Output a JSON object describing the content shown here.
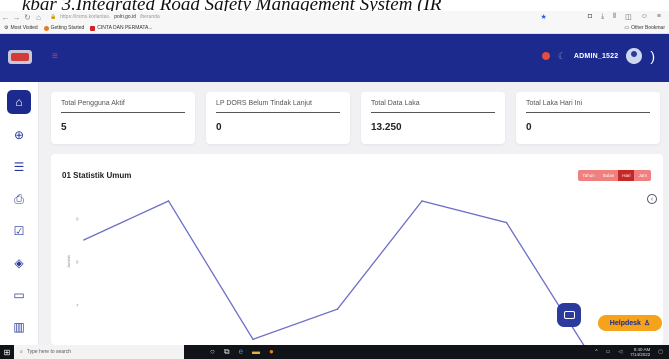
{
  "caption": "kbar 3.Integrated Road Safety Management System (IR",
  "browser": {
    "url_prefix": "https://irsms.korlantas.",
    "url_domain": "polri.go.id",
    "url_suffix": "/beranda",
    "bookmarks": [
      "Most Visited",
      "Getting Started",
      "CINTA DAN PERMATA..."
    ],
    "other_bookmarks": "Other Bookmar"
  },
  "header": {
    "admin_label": "ADMIN_1522"
  },
  "cards": [
    {
      "title": "Total Pengguna Aktif",
      "value": "5"
    },
    {
      "title": "LP DORS Belum Tindak Lanjut",
      "value": "0"
    },
    {
      "title": "Total Data Laka",
      "value": "13.250"
    },
    {
      "title": "Total Laka Hari Ini",
      "value": "0"
    }
  ],
  "panel": {
    "title": "01 Statistik Umum",
    "filters": [
      "Tahun",
      "Bulan",
      "Hari",
      "Jam"
    ],
    "active_filter": "Hari"
  },
  "chart_data": {
    "type": "line",
    "ylabel": "Jumlah",
    "y_ticks": [
      "9",
      "8",
      "7"
    ],
    "ylim": [
      6,
      9.7
    ],
    "values": [
      8.5,
      9.4,
      6.2,
      6.9,
      9.4,
      8.9,
      5.8
    ],
    "color": "#6c6fc6"
  },
  "helpdesk_label": "Helpdesk",
  "taskbar": {
    "search_placeholder": "Type here to search",
    "time": "9:40 AM",
    "date": "7/14/2022"
  }
}
